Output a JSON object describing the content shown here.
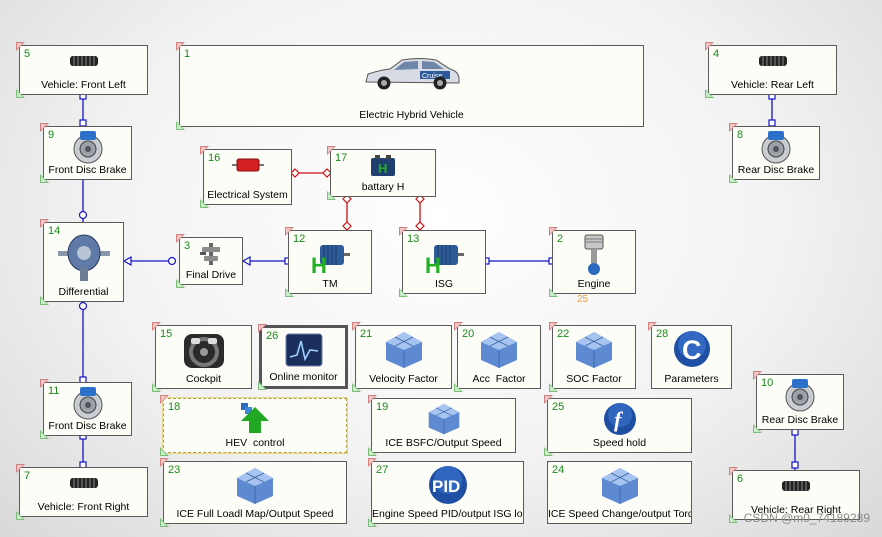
{
  "blocks": [
    {
      "num": "5",
      "label": "Vehicle: Front Left",
      "icon": "tire-icon"
    },
    {
      "num": "1",
      "label": "Electric Hybrid Vehicle",
      "icon": "car-icon"
    },
    {
      "num": "4",
      "label": "Vehicle: Rear Left",
      "icon": "tire-icon"
    },
    {
      "num": "9",
      "label": "Front Disc Brake",
      "icon": "disc-brake-icon"
    },
    {
      "num": "8",
      "label": "Rear Disc Brake",
      "icon": "disc-brake-icon"
    },
    {
      "num": "16",
      "label": "Electrical System",
      "icon": "wire-icon"
    },
    {
      "num": "17",
      "label": "battary H",
      "icon": "battery-icon"
    },
    {
      "num": "14",
      "label": "Differential",
      "icon": "differential-icon"
    },
    {
      "num": "3",
      "label": "Final Drive",
      "icon": "gear-shaft-icon"
    },
    {
      "num": "12",
      "label": "TM",
      "icon": "motor-icon"
    },
    {
      "num": "13",
      "label": "ISG",
      "icon": "motor-icon"
    },
    {
      "num": "2",
      "label": "Engine",
      "icon": "piston-icon"
    },
    {
      "num": "15",
      "label": "Cockpit",
      "icon": "steering-wheel-icon"
    },
    {
      "num": "26",
      "label": "Online monitor",
      "icon": "monitor-icon"
    },
    {
      "num": "21",
      "label": "Velocity Factor",
      "icon": "map-surface-icon"
    },
    {
      "num": "20",
      "label": "Acc  Factor",
      "icon": "map-surface-icon"
    },
    {
      "num": "22",
      "label": "SOC Factor",
      "icon": "map-surface-icon"
    },
    {
      "num": "28",
      "label": "Parameters",
      "icon": "parameters-icon"
    },
    {
      "num": "10",
      "label": "Rear Disc Brake",
      "icon": "disc-brake-icon"
    },
    {
      "num": "11",
      "label": "Front Disc Brake",
      "icon": "disc-brake-icon"
    },
    {
      "num": "18",
      "label": "HEV  control",
      "icon": "controller-icon"
    },
    {
      "num": "19",
      "label": "ICE BSFC/Output Speed",
      "icon": "map-surface-icon"
    },
    {
      "num": "25",
      "label": "Speed hold",
      "icon": "function-icon"
    },
    {
      "num": "7",
      "label": "Vehicle: Front Right",
      "icon": "tire-icon"
    },
    {
      "num": "23",
      "label": "ICE Full Loadl Map/Output Speed",
      "icon": "map-surface-icon"
    },
    {
      "num": "27",
      "label": "Engine Speed PID/output ISG loa",
      "icon": "pid-icon"
    },
    {
      "num": "24",
      "label": "ICE Speed Change/output Torq",
      "icon": "map-surface-icon"
    },
    {
      "num": "6",
      "label": "Vehicle: Rear Right",
      "icon": "tire-icon"
    }
  ],
  "car_badge": "Cruise",
  "pid_text": "PID",
  "param_glyph": "C",
  "function_glyph": "f",
  "engine_annotation": "25",
  "watermark": "CSDN @m0_74189289",
  "colors": {
    "mech": "#1414c8",
    "elec": "#d01010",
    "num": "#1a8a1a"
  }
}
